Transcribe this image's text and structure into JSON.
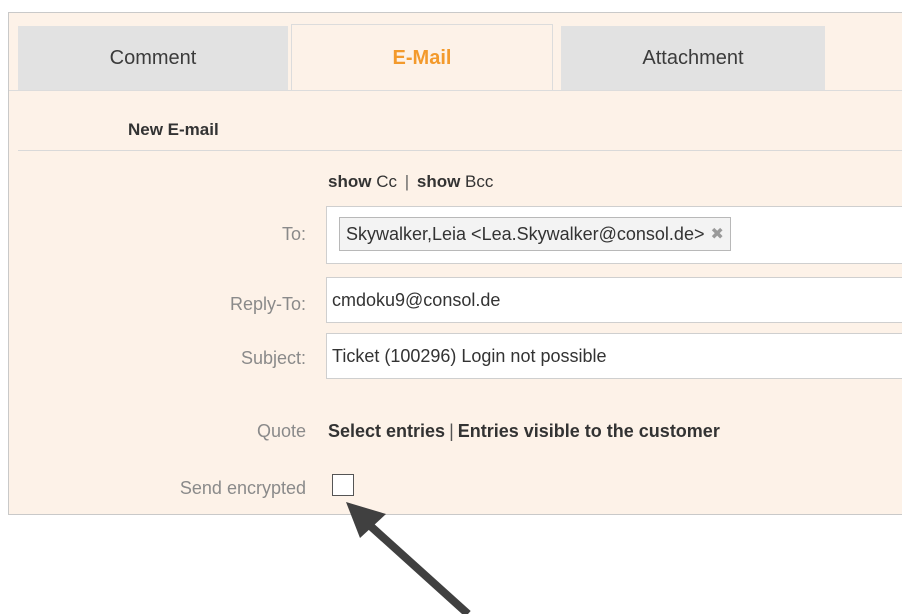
{
  "tabs": [
    {
      "label": "Comment",
      "active": false
    },
    {
      "label": "E-Mail",
      "active": true
    },
    {
      "label": "Attachment",
      "active": false
    }
  ],
  "colors": {
    "panel_background": "#fdf2e8",
    "active_tab_text": "#f39a2c",
    "inactive_tab_background": "#e2e2e2"
  },
  "form": {
    "section_title": "New E-mail",
    "show_cc": {
      "keyword": "show",
      "label": "Cc"
    },
    "separator": "|",
    "show_bcc": {
      "keyword": "show",
      "label": "Bcc"
    },
    "to": {
      "label": "To:",
      "recipient": "Skywalker,Leia <Lea.Skywalker@consol.de>",
      "remove_icon": "close-icon"
    },
    "reply_to": {
      "label": "Reply-To:",
      "value": "cmdoku9@consol.de"
    },
    "subject": {
      "label": "Subject:",
      "value": "Ticket (100296) Login not possible"
    },
    "quote": {
      "label": "Quote",
      "select_entries": "Select entries",
      "visible_entries": "Entries visible to the customer"
    },
    "send_encrypted": {
      "label": "Send encrypted",
      "checked": false
    }
  },
  "annotation": {
    "icon": "arrow-pointer-icon",
    "color": "#404040"
  }
}
